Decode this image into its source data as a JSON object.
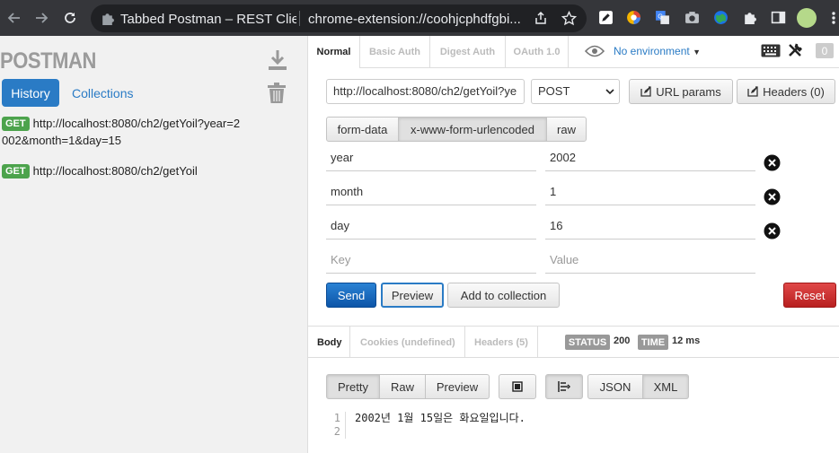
{
  "browser": {
    "tab_title": "Tabbed Postman – REST Clier",
    "url": "chrome-extension://coohjcphdfgbi..."
  },
  "sidebar": {
    "logo": "POSTMAN",
    "tabs": {
      "history": "History",
      "collections": "Collections"
    },
    "history_items": [
      {
        "method": "GET",
        "url_line1": "http://localhost:8080/ch2/getYoil?year=2",
        "url_line2": "002&month=1&day=15"
      },
      {
        "method": "GET",
        "url_line1": "http://localhost:8080/ch2/getYoil",
        "url_line2": ""
      }
    ]
  },
  "auth_tabs": [
    "Normal",
    "Basic Auth",
    "Digest Auth",
    "OAuth 1.0"
  ],
  "environment": "No environment",
  "env_count": "0",
  "request": {
    "url": "http://localhost:8080/ch2/getYoil?ye",
    "method": "POST",
    "url_params_label": "URL params",
    "headers_label": "Headers (0)"
  },
  "body_modes": [
    "form-data",
    "x-www-form-urlencoded",
    "raw"
  ],
  "params": [
    {
      "key": "year",
      "value": "2002"
    },
    {
      "key": "month",
      "value": "1"
    },
    {
      "key": "day",
      "value": "16"
    }
  ],
  "param_placeholders": {
    "key": "Key",
    "value": "Value"
  },
  "actions": {
    "send": "Send",
    "preview": "Preview",
    "add": "Add to collection",
    "reset": "Reset"
  },
  "response": {
    "tabs": [
      "Body",
      "Cookies (undefined)",
      "Headers (5)"
    ],
    "status_label": "STATUS",
    "status": "200",
    "time_label": "TIME",
    "time": "12 ms",
    "view_modes": [
      "Pretty",
      "Raw",
      "Preview"
    ],
    "formats": [
      "JSON",
      "XML"
    ],
    "lines": [
      {
        "num": "1",
        "text": "2002년 1월 15일은 화요일입니다."
      },
      {
        "num": "2",
        "text": ""
      }
    ]
  }
}
